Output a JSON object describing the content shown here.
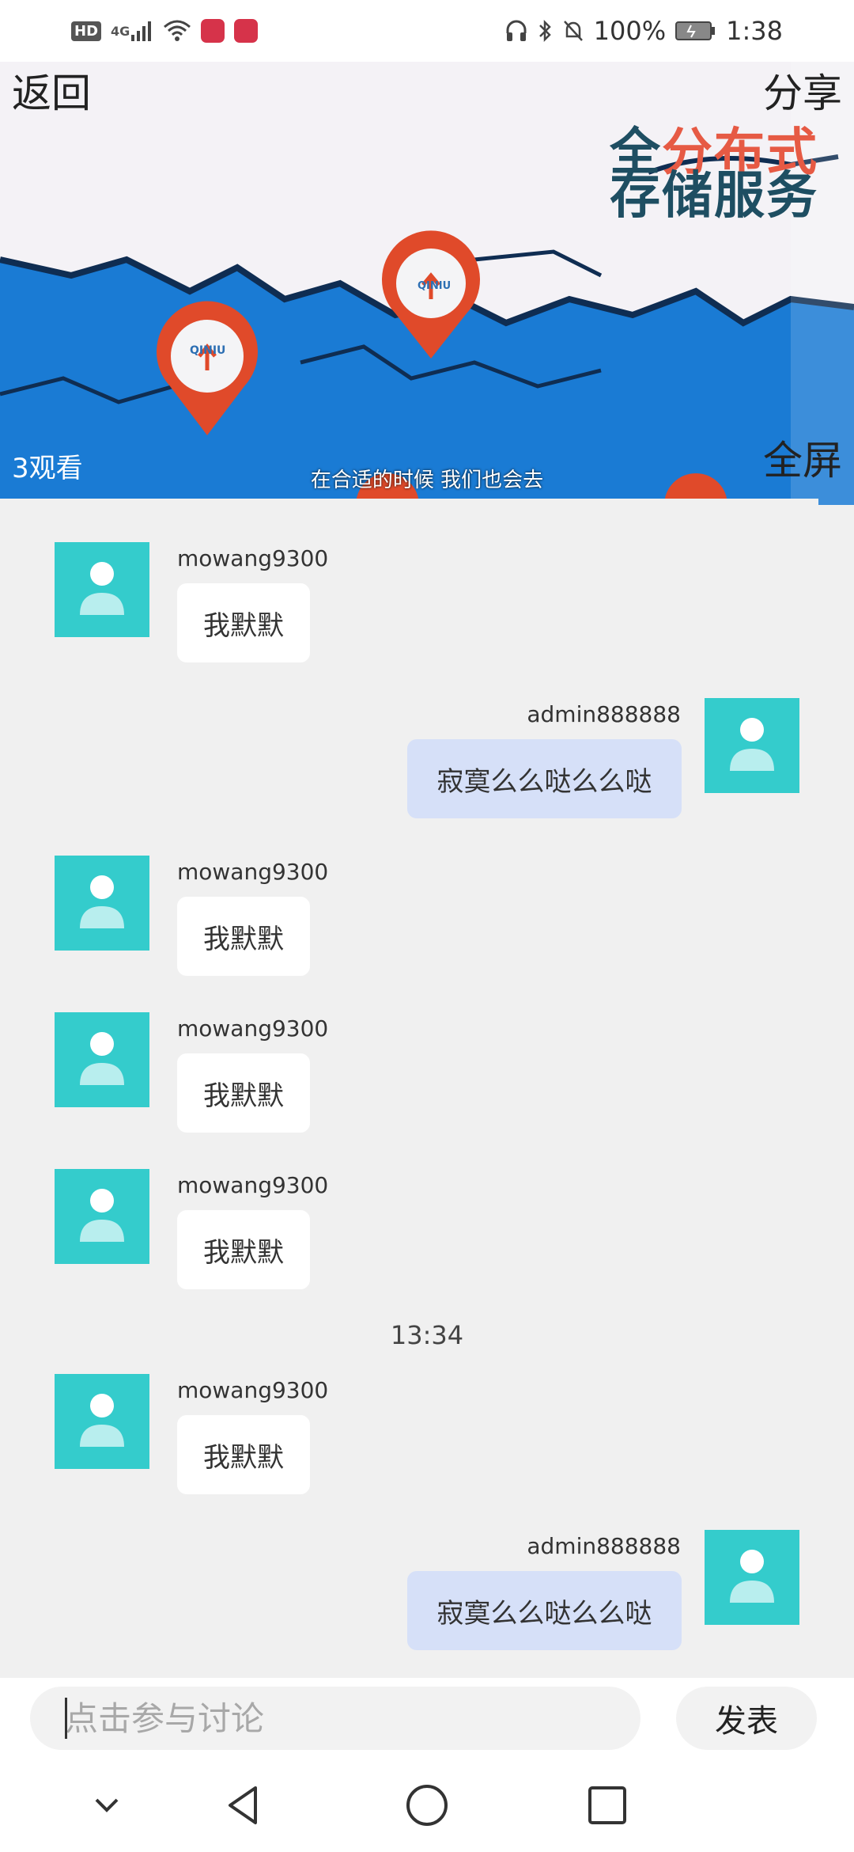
{
  "status_bar": {
    "hd": "HD",
    "network": "4G",
    "battery": "100%",
    "time": "1:38"
  },
  "video": {
    "back_label": "返回",
    "share_label": "分享",
    "fullscreen_label": "全屏",
    "viewers": "3观看",
    "subtitle": "在合适的时候  我们也会去",
    "overlay_title_part1": "全",
    "overlay_title_part2": "分布式",
    "overlay_title_line2": "存储服务",
    "pin_label": "QINIU"
  },
  "messages": [
    {
      "side": "in",
      "user": "mowang9300",
      "text": "我默默"
    },
    {
      "side": "out",
      "user": "admin888888",
      "text": "寂寞么么哒么么哒"
    },
    {
      "side": "in",
      "user": "mowang9300",
      "text": "我默默"
    },
    {
      "side": "in",
      "user": "mowang9300",
      "text": "我默默"
    },
    {
      "side": "in",
      "user": "mowang9300",
      "text": "我默默"
    },
    {
      "side": "time",
      "text": "13:34"
    },
    {
      "side": "in",
      "user": "mowang9300",
      "text": "我默默"
    },
    {
      "side": "out",
      "user": "admin888888",
      "text": "寂寞么么哒么么哒"
    }
  ],
  "input": {
    "placeholder": "点击参与讨论",
    "send_label": "发表"
  },
  "colors": {
    "avatar_bg": "#34cccc",
    "incoming_bubble": "#ffffff",
    "outgoing_bubble": "#d6e0f8",
    "chat_bg": "#f0f0f0"
  }
}
